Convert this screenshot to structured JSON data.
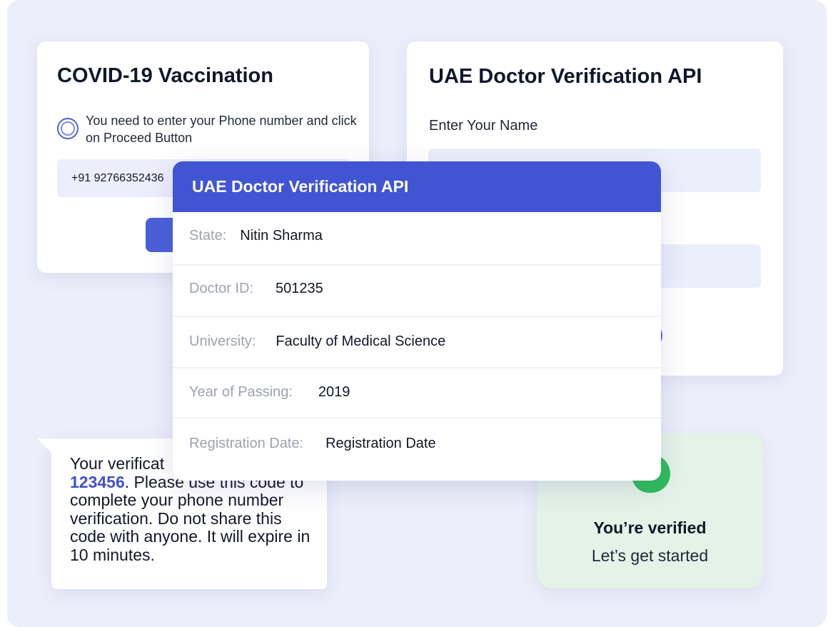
{
  "covid_card": {
    "title": "COVID-19 Vaccination",
    "instruction": "You need to enter your Phone number and click on Proceed Button",
    "phone_value": "+91 92766352436"
  },
  "form_card": {
    "title": "UAE Doctor Verification API",
    "name_label": "Enter Your Name"
  },
  "detail_card": {
    "header": "UAE Doctor Verification API",
    "rows": [
      {
        "label": "State:",
        "value": "Nitin Sharma"
      },
      {
        "label": "Doctor ID:",
        "value": "501235"
      },
      {
        "label": "University:",
        "value": "Faculty of Medical Science"
      },
      {
        "label": "Year of Passing:",
        "value": "2019"
      },
      {
        "label": "Registration Date:",
        "value": "Registration Date"
      }
    ]
  },
  "sms": {
    "prefix": "Your verificat",
    "code": "123456",
    "body": ". Please use this code to complete your phone number verification. Do not share this code with anyone. It will expire in 10 minutes."
  },
  "verified": {
    "title": "You’re verified",
    "subtitle": "Let’s get started"
  },
  "colors": {
    "accent": "#4054d4",
    "background": "#eceef9",
    "success": "#2fbd59",
    "success_bg": "#e3f3e7"
  }
}
